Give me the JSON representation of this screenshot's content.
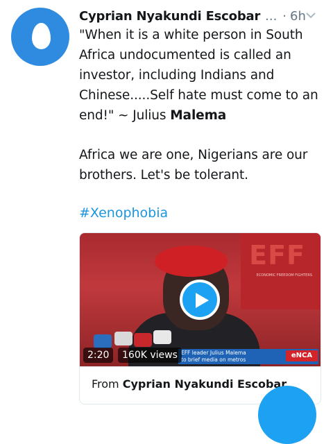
{
  "tweet": {
    "author_name": "Cyprian Nyakundi Escobar",
    "name_truncation": "...",
    "separator": "·",
    "time": "6h",
    "paragraph1_before": "\"When it is a white person in South Africa undocumented is called an investor, including Indians and Chinese.....Self hate must come to an end!\" ~ Julius ",
    "paragraph1_bold": "Malema",
    "paragraph2": "Africa we are one, Nigerians are our brothers. Let's be tolerant.",
    "hashtag": "#Xenophobia"
  },
  "media": {
    "duration": "2:20",
    "views": "160K views",
    "overlay_logo_text": "EFF",
    "overlay_logo_subtext": "ECONOMIC FREEDOM FIGHTERS",
    "ticker_line1": "EFF leader Julius Malema",
    "ticker_line2": "to brief media on metros",
    "channel_logo": "eNCA",
    "from_label": "From",
    "source_name": "Cyprian Nyakundi Escobar"
  },
  "icons": {
    "chevron": "chevron-down-icon",
    "play": "play-icon"
  },
  "colors": {
    "accent": "#1da1f2",
    "hashtag": "#1b95e0",
    "avatar_bg": "#2f8be0",
    "muted": "#657786"
  }
}
